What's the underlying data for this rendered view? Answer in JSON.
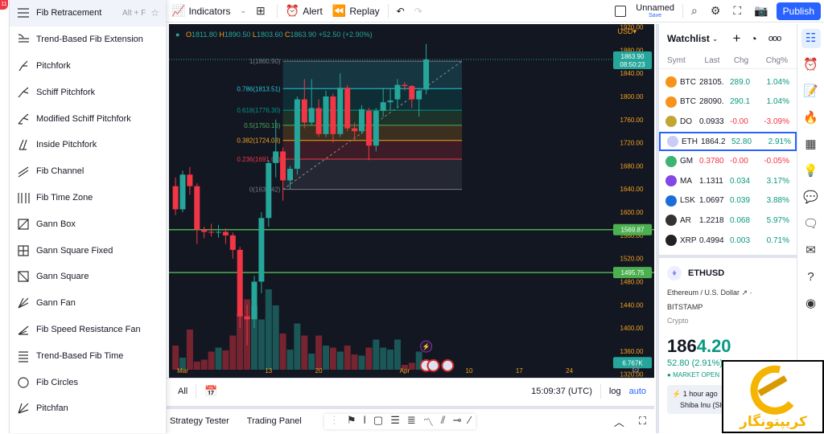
{
  "left_toolbar": {
    "badge": "11"
  },
  "drawing_menu": {
    "items": [
      {
        "label": "Fib Retracement",
        "shortcut": "Alt + F",
        "active": true
      },
      {
        "label": "Trend-Based Fib Extension"
      },
      {
        "label": "Pitchfork"
      },
      {
        "label": "Schiff Pitchfork"
      },
      {
        "label": "Modified Schiff Pitchfork"
      },
      {
        "label": "Inside Pitchfork"
      },
      {
        "label": "Fib Channel"
      },
      {
        "label": "Fib Time Zone"
      },
      {
        "label": "Gann Box"
      },
      {
        "label": "Gann Square Fixed"
      },
      {
        "label": "Gann Square"
      },
      {
        "label": "Gann Fan"
      },
      {
        "label": "Fib Speed Resistance Fan"
      },
      {
        "label": "Trend-Based Fib Time"
      },
      {
        "label": "Fib Circles"
      },
      {
        "label": "Pitchfan"
      }
    ]
  },
  "topbar": {
    "indicators": "Indicators",
    "alert": "Alert",
    "replay": "Replay",
    "layout_name": "Unnamed",
    "save": "Save",
    "publish": "Publish"
  },
  "chart": {
    "ohlc": {
      "o": "1811.80",
      "h": "1890.50",
      "l": "1803.60",
      "c": "1863.90",
      "chg": "+52.50 (+2.90%)"
    },
    "currency": "USD",
    "price_ticks": [
      "1920.00",
      "1880.00",
      "1840.00",
      "1800.00",
      "1760.00",
      "1720.00",
      "1680.00",
      "1640.00",
      "1600.00",
      "1560.00",
      "1520.00",
      "1480.00",
      "1440.00",
      "1400.00",
      "1360.00",
      "1320.00"
    ],
    "price_range": [
      1314,
      1925
    ],
    "date_ticks": [
      {
        "label": "Mar",
        "date": "03-01"
      },
      {
        "label": "13",
        "date": "03-13"
      },
      {
        "label": "20",
        "date": "03-20"
      },
      {
        "label": "Apr",
        "date": "04-01"
      },
      {
        "label": "10",
        "date": "04-10"
      },
      {
        "label": "17",
        "date": "04-17"
      },
      {
        "label": "24",
        "date": "04-24"
      }
    ],
    "last_price": "1863.90",
    "countdown": "08:50:23",
    "volume_label": "6.767K",
    "horizontal_lines": [
      {
        "value": 1569.87,
        "label": "1569.87"
      },
      {
        "value": 1495.75,
        "label": "1495.75"
      }
    ],
    "colors": {
      "up": "#26a69a",
      "down": "#f23645",
      "hline": "#4caf50",
      "axis_text": "#f7a21b"
    },
    "fib": {
      "start": "03-15",
      "end": "04-09",
      "levels": [
        {
          "label": "1(1860.90)",
          "value": 1860.9,
          "color": "#787b86"
        },
        {
          "label": "0.786(1813.51)",
          "value": 1813.51,
          "color": "#26c6da"
        },
        {
          "label": "0.618(1776.30)",
          "value": 1776.3,
          "color": "#009688"
        },
        {
          "label": "0.5(1750.16)",
          "value": 1750.16,
          "color": "#4caf50"
        },
        {
          "label": "0.382(1724.03)",
          "value": 1724.03,
          "color": "#f7a21b"
        },
        {
          "label": "0.236(1691.69)",
          "value": 1691.69,
          "color": "#f23645"
        },
        {
          "label": "0(1639.42)",
          "value": 1639.42,
          "color": "#787b86"
        }
      ]
    },
    "candles": [
      [
        "02-28",
        1645,
        1660,
        1595,
        1605,
        60
      ],
      [
        "03-01",
        1605,
        1672,
        1600,
        1665,
        30
      ],
      [
        "03-02",
        1665,
        1678,
        1630,
        1645,
        100
      ],
      [
        "03-03",
        1645,
        1650,
        1545,
        1570,
        20
      ],
      [
        "03-04",
        1570,
        1575,
        1555,
        1566,
        25
      ],
      [
        "03-05",
        1566,
        1580,
        1558,
        1565,
        45
      ],
      [
        "03-06",
        1565,
        1578,
        1556,
        1566,
        55
      ],
      [
        "03-07",
        1566,
        1572,
        1545,
        1560,
        48
      ],
      [
        "03-08",
        1560,
        1565,
        1520,
        1535,
        85
      ],
      [
        "03-09",
        1535,
        1540,
        1400,
        1420,
        140
      ],
      [
        "03-10",
        1420,
        1440,
        1370,
        1415,
        175
      ],
      [
        "03-11",
        1415,
        1490,
        1400,
        1480,
        160
      ],
      [
        "03-12",
        1480,
        1600,
        1460,
        1590,
        125
      ],
      [
        "03-13",
        1590,
        1690,
        1575,
        1685,
        200
      ],
      [
        "03-14",
        1685,
        1760,
        1660,
        1705,
        160
      ],
      [
        "03-15",
        1705,
        1712,
        1620,
        1655,
        90
      ],
      [
        "03-16",
        1655,
        1680,
        1640,
        1675,
        50
      ],
      [
        "03-17",
        1675,
        1800,
        1665,
        1795,
        115
      ],
      [
        "03-18",
        1795,
        1830,
        1745,
        1755,
        85
      ],
      [
        "03-19",
        1755,
        1830,
        1750,
        1780,
        40
      ],
      [
        "03-20",
        1780,
        1795,
        1730,
        1735,
        85
      ],
      [
        "03-21",
        1735,
        1810,
        1730,
        1800,
        60
      ],
      [
        "03-22",
        1800,
        1805,
        1720,
        1735,
        55
      ],
      [
        "03-23",
        1735,
        1840,
        1730,
        1815,
        45
      ],
      [
        "03-24",
        1815,
        1820,
        1740,
        1745,
        60
      ],
      [
        "03-25",
        1745,
        1755,
        1725,
        1740,
        38
      ],
      [
        "03-26",
        1740,
        1785,
        1735,
        1778,
        35
      ],
      [
        "03-27",
        1775,
        1780,
        1690,
        1715,
        55
      ],
      [
        "03-28",
        1715,
        1780,
        1705,
        1775,
        75
      ],
      [
        "03-29",
        1775,
        1815,
        1765,
        1790,
        55
      ],
      [
        "03-30",
        1790,
        1815,
        1775,
        1793,
        50
      ],
      [
        "03-31",
        1795,
        1830,
        1780,
        1820,
        75
      ],
      [
        "04-01",
        1820,
        1825,
        1810,
        1818,
        12
      ],
      [
        "04-02",
        1818,
        1820,
        1780,
        1795,
        17
      ],
      [
        "04-03",
        1795,
        1815,
        1765,
        1810,
        45
      ],
      [
        "04-04",
        1811.8,
        1890.5,
        1803.6,
        1863.9,
        6.767
      ]
    ]
  },
  "timebar": {
    "range_all": "All",
    "time": "15:09:37 (UTC)",
    "log": "log",
    "auto": "auto"
  },
  "bottombar": {
    "strategy_tester": "Strategy Tester",
    "trading_panel": "Trading Panel"
  },
  "watchlist": {
    "title": "Watchlist",
    "columns": [
      "Symt",
      "Last",
      "Chg",
      "Chg%"
    ],
    "rows": [
      {
        "sym": "BTC",
        "last": "28105.",
        "chg": "289.0",
        "pct": "1.04%",
        "dir": "up",
        "color": "#f7931a"
      },
      {
        "sym": "BTC",
        "last": "28090.",
        "chg": "290.1",
        "pct": "1.04%",
        "dir": "up",
        "color": "#f7931a"
      },
      {
        "sym": "DO",
        "last": "0.0933",
        "chg": "-0.00",
        "pct": "-3.09%",
        "dir": "dn",
        "color": "#c2a633"
      },
      {
        "sym": "ETH",
        "last": "1864.2",
        "chg": "52.80",
        "pct": "2.91%",
        "dir": "up",
        "color": "#c9cdf5",
        "selected": true
      },
      {
        "sym": "GM",
        "last": "0.3780",
        "chg": "-0.00",
        "pct": "-0.05%",
        "dir": "dn",
        "color": "#3cb371",
        "lastdir": "dn"
      },
      {
        "sym": "MA",
        "last": "1.1311",
        "chg": "0.034",
        "pct": "3.17%",
        "dir": "up",
        "color": "#8247e5"
      },
      {
        "sym": "LSK",
        "last": "1.0697",
        "chg": "0.039",
        "pct": "3.88%",
        "dir": "up",
        "color": "#1a6ed8"
      },
      {
        "sym": "AR",
        "last": "1.2218",
        "chg": "0.068",
        "pct": "5.97%",
        "dir": "up",
        "color": "#333"
      },
      {
        "sym": "XRP",
        "last": "0.4994",
        "chg": "0.003",
        "pct": "0.71%",
        "dir": "up",
        "color": "#222"
      }
    ],
    "detail": {
      "symbol": "ETHUSD",
      "name": "Ethereum / U.S. Dollar",
      "exchange": "BITSTAMP",
      "type": "Crypto",
      "price_main": "186",
      "price_frac": "4.20",
      "change": "52.80 (2.91%)",
      "status": "MARKET OPEN",
      "news_time": "1 hour ago",
      "news_text": "Shiba Inu (SH"
    }
  },
  "watermark": {
    "text": "کریپتونگار",
    "color": "#f5b400"
  }
}
